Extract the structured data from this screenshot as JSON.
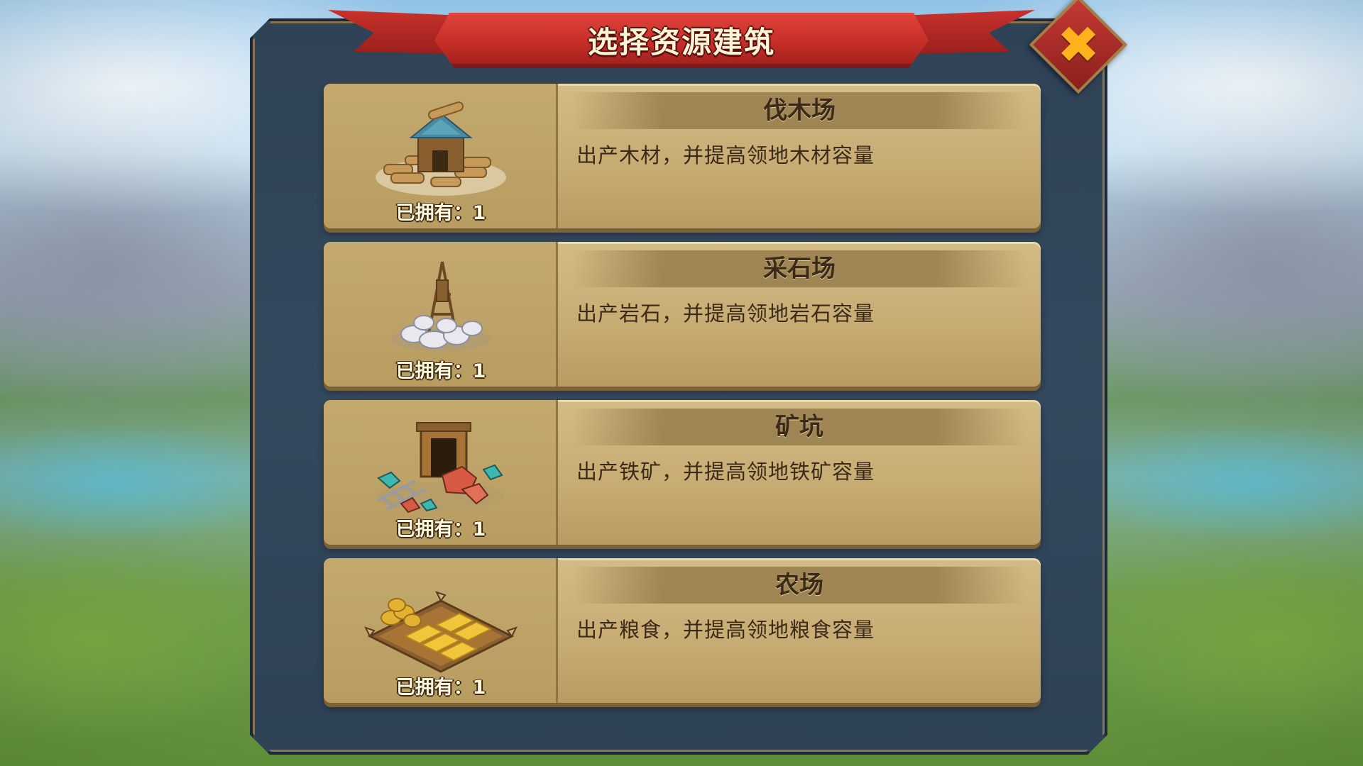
{
  "dialog": {
    "title": "选择资源建筑",
    "close_icon": "close-x-icon"
  },
  "buildings": [
    {
      "name": "伐木场",
      "description": "出产木材，并提高领地木材容量",
      "owned": "已拥有：1",
      "icon": "lumber-mill-icon"
    },
    {
      "name": "采石场",
      "description": "出产岩石，并提高领地岩石容量",
      "owned": "已拥有：1",
      "icon": "quarry-icon"
    },
    {
      "name": "矿坑",
      "description": "出产铁矿，并提高领地铁矿容量",
      "owned": "已拥有：1",
      "icon": "mine-icon"
    },
    {
      "name": "农场",
      "description": "出产粮食，并提高领地粮食容量",
      "owned": "已拥有：1",
      "icon": "farm-icon"
    }
  ],
  "colors": {
    "ribbon": "#c52e28",
    "close_glyph": "#ffb21c",
    "card": "#c6ab72",
    "text": "#3b2a17"
  }
}
